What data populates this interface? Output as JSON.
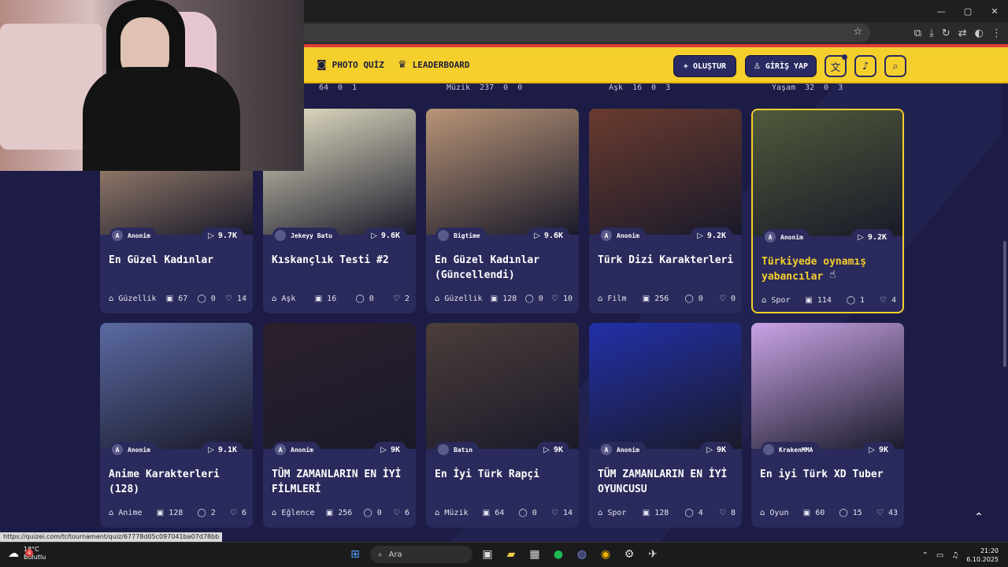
{
  "browser": {
    "window_controls": [
      "—",
      "▢",
      "✕"
    ],
    "status_url": "https://quizei.com/tr/tournament/quiz/67778d05c097041ba07d78bb"
  },
  "nav": {
    "photo_quiz": "PHOTO QUİZ",
    "leaderboard": "LEADERBOARD",
    "create": "OLUŞTUR",
    "login": "GİRİŞ YAP"
  },
  "partial_rows": [
    [
      "64",
      "0",
      "1"
    ],
    [
      "Müzik",
      "237",
      "0",
      "0"
    ],
    [
      "Aşk",
      "16",
      "0",
      "3"
    ],
    [
      "Yaşam",
      "32",
      "0",
      "3"
    ]
  ],
  "cards": [
    {
      "author": "Anonim",
      "avatar": "A",
      "plays": "9.7K",
      "title": "En Güzel Kadınlar",
      "category": "Güzellik",
      "images": "67",
      "comments": "0",
      "likes": "14",
      "thumb_color": "#c9a587"
    },
    {
      "author": "Jekeyy Batu",
      "avatar": "",
      "plays": "9.6K",
      "title": "Kıskançlık Testi #2",
      "category": "Aşk",
      "images": "16",
      "comments": "0",
      "likes": "2",
      "thumb_color": "#e9e4c8"
    },
    {
      "author": "Bigtime",
      "avatar": "",
      "plays": "9.6K",
      "title": "En Güzel Kadınlar (Güncellendi)",
      "category": "Güzellik",
      "images": "128",
      "comments": "0",
      "likes": "10",
      "thumb_color": "#b89477"
    },
    {
      "author": "Anonim",
      "avatar": "A",
      "plays": "9.2K",
      "title": "Türk Dizi Karakterleri",
      "category": "Film",
      "images": "256",
      "comments": "0",
      "likes": "0",
      "thumb_color": "#6a3b2f"
    },
    {
      "author": "Anonim",
      "avatar": "A",
      "plays": "9.2K",
      "title": "Türkiyede oynamış yabancılar",
      "category": "Spor",
      "images": "114",
      "comments": "1",
      "likes": "4",
      "thumb_color": "#4f5a3a"
    },
    {
      "author": "Anonim",
      "avatar": "A",
      "plays": "9.1K",
      "title": "Anime Karakterleri (128)",
      "category": "Anime",
      "images": "128",
      "comments": "2",
      "likes": "6",
      "thumb_color": "#5b6aa3"
    },
    {
      "author": "Anonim",
      "avatar": "A",
      "plays": "9K",
      "title": "TÜM ZAMANLARIN EN İYİ FİLMLERİ",
      "category": "Eğlence",
      "images": "256",
      "comments": "0",
      "likes": "6",
      "thumb_color": "#2c1f2c"
    },
    {
      "author": "Batın",
      "avatar": "",
      "plays": "9K",
      "title": "En İyi Türk Rapçi",
      "category": "Müzik",
      "images": "64",
      "comments": "0",
      "likes": "14",
      "thumb_color": "#4b3d3a"
    },
    {
      "author": "Anonim",
      "avatar": "A",
      "plays": "9K",
      "title": "TÜM ZAMANLARIN EN İYİ OYUNCUSU",
      "category": "Spor",
      "images": "128",
      "comments": "4",
      "likes": "8",
      "thumb_color": "#2230a8"
    },
    {
      "author": "KrakenMMA",
      "avatar": "",
      "plays": "9K",
      "title": "En iyi Türk XD Tuber",
      "category": "Oyun",
      "images": "60",
      "comments": "15",
      "likes": "43",
      "thumb_color": "#c9a4e6"
    }
  ],
  "taskbar": {
    "temp": "18°C",
    "weather": "Bulutlu",
    "search": "Ara",
    "time": "21:20",
    "date": "6.10.2025",
    "badge": "4"
  }
}
